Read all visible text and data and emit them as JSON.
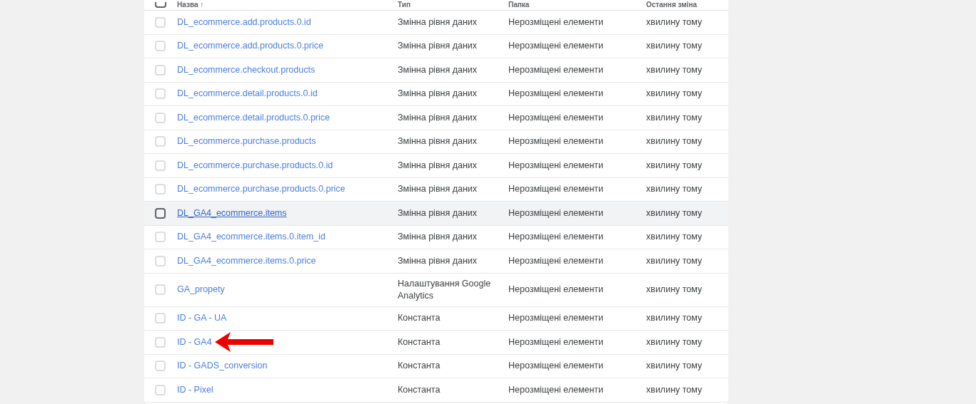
{
  "table": {
    "select_all_checked": false,
    "columns": [
      "Назва ↑",
      "Тип",
      "Папка",
      "Остання зміна"
    ],
    "rows": [
      {
        "name": "DL_ecommerce.add.products.0.id",
        "type": "Змінна рівня даних",
        "folder": "Нерозміщені елементи",
        "updated": "хвилину тому",
        "hovered": false,
        "arrow": false
      },
      {
        "name": "DL_ecommerce.add.products.0.price",
        "type": "Змінна рівня даних",
        "folder": "Нерозміщені елементи",
        "updated": "хвилину тому",
        "hovered": false,
        "arrow": false
      },
      {
        "name": "DL_ecommerce.checkout.products",
        "type": "Змінна рівня даних",
        "folder": "Нерозміщені елементи",
        "updated": "хвилину тому",
        "hovered": false,
        "arrow": false
      },
      {
        "name": "DL_ecommerce.detail.products.0.id",
        "type": "Змінна рівня даних",
        "folder": "Нерозміщені елементи",
        "updated": "хвилину тому",
        "hovered": false,
        "arrow": false
      },
      {
        "name": "DL_ecommerce.detail.products.0.price",
        "type": "Змінна рівня даних",
        "folder": "Нерозміщені елементи",
        "updated": "хвилину тому",
        "hovered": false,
        "arrow": false
      },
      {
        "name": "DL_ecommerce.purchase.products",
        "type": "Змінна рівня даних",
        "folder": "Нерозміщені елементи",
        "updated": "хвилину тому",
        "hovered": false,
        "arrow": false
      },
      {
        "name": "DL_ecommerce.purchase.products.0.id",
        "type": "Змінна рівня даних",
        "folder": "Нерозміщені елементи",
        "updated": "хвилину тому",
        "hovered": false,
        "arrow": false
      },
      {
        "name": "DL_ecommerce.purchase.products.0.price",
        "type": "Змінна рівня даних",
        "folder": "Нерозміщені елементи",
        "updated": "хвилину тому",
        "hovered": false,
        "arrow": false
      },
      {
        "name": "DL_GA4_ecommerce.items",
        "type": "Змінна рівня даних",
        "folder": "Нерозміщені елементи",
        "updated": "хвилину тому",
        "hovered": true,
        "arrow": false
      },
      {
        "name": "DL_GA4_ecommerce.items.0.item_id",
        "type": "Змінна рівня даних",
        "folder": "Нерозміщені елементи",
        "updated": "хвилину тому",
        "hovered": false,
        "arrow": false
      },
      {
        "name": "DL_GA4_ecommerce.items.0.price",
        "type": "Змінна рівня даних",
        "folder": "Нерозміщені елементи",
        "updated": "хвилину тому",
        "hovered": false,
        "arrow": false
      },
      {
        "name": "GA_propety",
        "type": "Налаштування Google Analytics",
        "folder": "Нерозміщені елементи",
        "updated": "хвилину тому",
        "hovered": false,
        "arrow": false
      },
      {
        "name": "ID - GA - UA",
        "type": "Константа",
        "folder": "Нерозміщені елементи",
        "updated": "хвилину тому",
        "hovered": false,
        "arrow": false
      },
      {
        "name": "ID - GA4",
        "type": "Константа",
        "folder": "Нерозміщені елементи",
        "updated": "хвилину тому",
        "hovered": false,
        "arrow": true
      },
      {
        "name": "ID - GADS_conversion",
        "type": "Константа",
        "folder": "Нерозміщені елементи",
        "updated": "хвилину тому",
        "hovered": false,
        "arrow": false
      },
      {
        "name": "ID - Pixel",
        "type": "Константа",
        "folder": "Нерозміщені елементи",
        "updated": "хвилину тому",
        "hovered": false,
        "arrow": false
      }
    ]
  }
}
